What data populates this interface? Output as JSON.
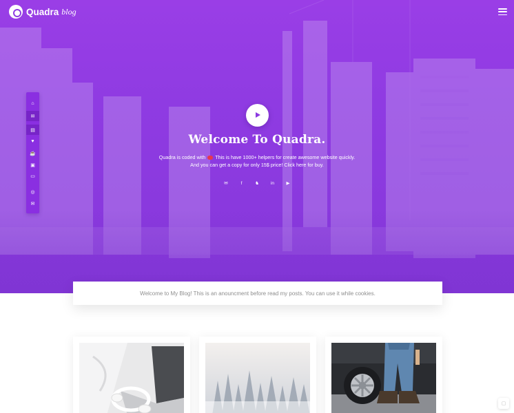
{
  "brand": {
    "name": "Quadra",
    "tagline": "blog"
  },
  "hero": {
    "title": "Welcome To Quadra.",
    "intro_line1_pre": "Quadra is coded with",
    "intro_line1_post": "This is have 1000+ helpers for create awesome website quickly.",
    "intro_line2": "And you can get a copy for only 15$ price! Click here for buy."
  },
  "sidebar": {
    "items": [
      {
        "icon": "home-icon",
        "glyph": "⌂",
        "active": false
      },
      {
        "icon": "chat-icon",
        "glyph": "✉",
        "active": true
      },
      {
        "icon": "document-icon",
        "glyph": "▤",
        "active": true
      },
      {
        "icon": "heart-icon",
        "glyph": "♥",
        "active": false
      },
      {
        "icon": "coffee-icon",
        "glyph": "☕",
        "active": false
      },
      {
        "icon": "bus-icon",
        "glyph": "▣",
        "active": false
      },
      {
        "icon": "briefcase-icon",
        "glyph": "▭",
        "active": false
      },
      {
        "icon": "instagram-icon",
        "glyph": "◎",
        "active": false
      },
      {
        "icon": "mail-icon",
        "glyph": "✉",
        "active": false
      }
    ]
  },
  "hero_social": [
    {
      "icon": "email-icon",
      "glyph": "✉"
    },
    {
      "icon": "facebook-icon",
      "glyph": "f"
    },
    {
      "icon": "twitter-icon",
      "glyph": "♞"
    },
    {
      "icon": "linkedin-icon",
      "glyph": "in"
    },
    {
      "icon": "youtube-icon",
      "glyph": "▶"
    }
  ],
  "announcement": "Welcome to My Blog! This is an anouncment before read my posts. You can use it while cookies.",
  "colors": {
    "accent": "#8b3ae0",
    "accent_dark": "#7724c8",
    "heart": "#e8384d"
  }
}
